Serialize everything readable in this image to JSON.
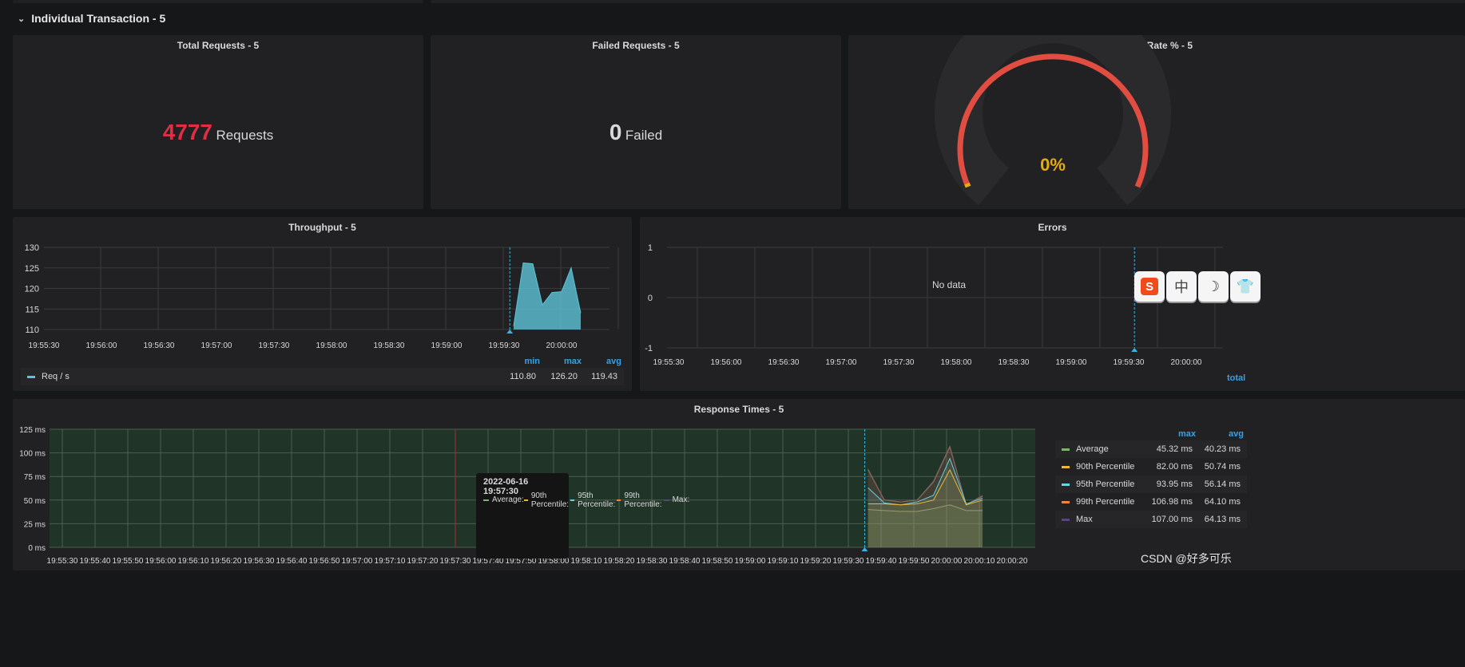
{
  "row": {
    "title": "Individual Transaction - 5"
  },
  "stats": [
    {
      "title": "Total Requests - 5",
      "value": "4777",
      "unit": "Requests",
      "color": "#e02f44"
    },
    {
      "title": "Failed Requests - 5",
      "value": "0",
      "unit": "Failed",
      "color": "#d8d9da"
    }
  ],
  "gauge": {
    "title": "Error Rate % - 5",
    "value": "0%",
    "percent": 0,
    "color": "#e5ac0e",
    "arc_color": "#e24d42"
  },
  "throughput": {
    "title": "Throughput - 5",
    "legend_headers": [
      "min",
      "max",
      "avg"
    ],
    "legend": [
      {
        "name": "Req / s",
        "min": "110.80",
        "max": "126.20",
        "avg": "119.43",
        "color": "#5ec4d8"
      }
    ]
  },
  "errors": {
    "title": "Errors",
    "no_data": "No data",
    "legend_header": "total"
  },
  "response": {
    "title": "Response Times - 5",
    "legend_headers": [
      "max",
      "avg"
    ],
    "legend": [
      {
        "name": "Average",
        "max": "45.32 ms",
        "avg": "40.23 ms",
        "color": "#7eb26d"
      },
      {
        "name": "90th Percentile",
        "max": "82.00 ms",
        "avg": "50.74 ms",
        "color": "#eab839"
      },
      {
        "name": "95th Percentile",
        "max": "93.95 ms",
        "avg": "56.14 ms",
        "color": "#6ed0e0"
      },
      {
        "name": "99th Percentile",
        "max": "106.98 ms",
        "avg": "64.10 ms",
        "color": "#ef843c"
      },
      {
        "name": "Max",
        "max": "107.00 ms",
        "avg": "64.13 ms",
        "color": "#584477"
      }
    ]
  },
  "tooltip": {
    "time": "2022-06-16 19:57:30",
    "items": [
      "Average:",
      "90th Percentile:",
      "95th Percentile:",
      "99th Percentile:",
      "Max:"
    ]
  },
  "watermark": "CSDN @好多可乐",
  "ime": {
    "icons": [
      "sogou-icon",
      "chinese-mode-icon",
      "moon-icon",
      "skin-icon"
    ],
    "labels": [
      "S",
      "中",
      "☽",
      "👕"
    ]
  },
  "chart_data": [
    {
      "type": "area",
      "title": "Throughput - 5",
      "ylim": [
        110,
        130
      ],
      "yticks": [
        110,
        115,
        120,
        125,
        130
      ],
      "xticks": [
        "19:55:30",
        "19:56:00",
        "19:56:30",
        "19:57:00",
        "19:57:30",
        "19:58:00",
        "19:58:30",
        "19:59:00",
        "19:59:30",
        "20:00:00"
      ],
      "series": [
        {
          "name": "Req / s",
          "x": [
            "19:59:35",
            "19:59:40",
            "19:59:45",
            "19:59:50",
            "19:59:55",
            "20:00:00",
            "20:00:05",
            "20:00:10"
          ],
          "values": [
            110.8,
            126.2,
            126.0,
            116.0,
            119.0,
            119.2,
            125.0,
            114.0
          ]
        }
      ]
    },
    {
      "type": "line",
      "title": "Errors",
      "ylim": [
        -1,
        1
      ],
      "yticks": [
        -1,
        0,
        1
      ],
      "xticks": [
        "19:55:30",
        "19:56:00",
        "19:56:30",
        "19:57:00",
        "19:57:30",
        "19:58:00",
        "19:58:30",
        "19:59:00",
        "19:59:30",
        "20:00:00"
      ],
      "series": []
    },
    {
      "type": "area",
      "title": "Response Times - 5",
      "ylim": [
        0,
        125
      ],
      "yticks": [
        "0 ms",
        "25 ms",
        "50 ms",
        "75 ms",
        "100 ms",
        "125 ms"
      ],
      "xticks": [
        "19:55:30",
        "19:55:40",
        "19:55:50",
        "19:56:00",
        "19:56:10",
        "19:56:20",
        "19:56:30",
        "19:56:40",
        "19:56:50",
        "19:57:00",
        "19:57:10",
        "19:57:20",
        "19:57:30",
        "19:57:40",
        "19:57:50",
        "19:58:00",
        "19:58:10",
        "19:58:20",
        "19:58:30",
        "19:58:40",
        "19:58:50",
        "19:59:00",
        "19:59:10",
        "19:59:20",
        "19:59:30",
        "19:59:40",
        "19:59:50",
        "20:00:00",
        "20:00:10",
        "20:00:20"
      ],
      "x": [
        "19:59:36",
        "19:59:41",
        "19:59:46",
        "19:59:51",
        "19:59:56",
        "20:00:01",
        "20:00:06",
        "20:00:11"
      ],
      "series": [
        {
          "name": "Max",
          "values": [
            83,
            50,
            48,
            50,
            70,
            107,
            45,
            55
          ]
        },
        {
          "name": "99th Percentile",
          "values": [
            82,
            50,
            48,
            50,
            69,
            106,
            45,
            54
          ]
        },
        {
          "name": "95th Percentile",
          "values": [
            63,
            47,
            45,
            48,
            55,
            94,
            46,
            52
          ]
        },
        {
          "name": "90th Percentile",
          "values": [
            46,
            46,
            45,
            46,
            50,
            82,
            45,
            50
          ]
        },
        {
          "name": "Average",
          "values": [
            40,
            39,
            38,
            38,
            41,
            45,
            39,
            39
          ]
        }
      ]
    }
  ]
}
